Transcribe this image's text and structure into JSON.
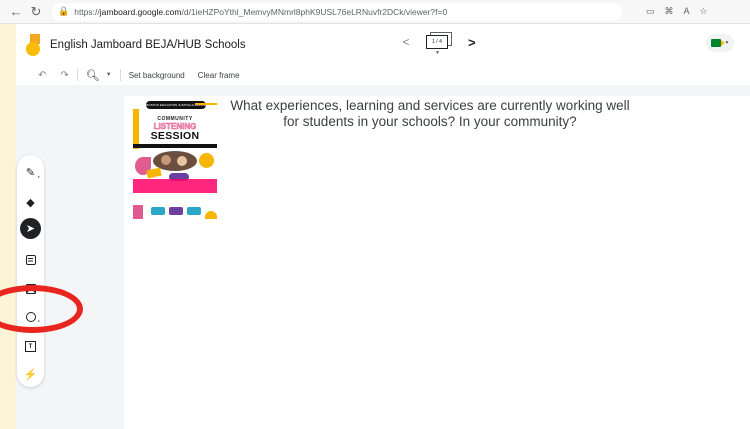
{
  "browser": {
    "url_prefix": "https://",
    "url_host": "jamboard.google.com",
    "url_path": "/d/1ieHZPoYthl_MemvyMNmrl8phK9USL76eLRNuvfr2DCk/viewer?f=0"
  },
  "app": {
    "title": "English Jamboard BEJA/HUB Schools",
    "frame_indicator": "1 / 4"
  },
  "toolbar": {
    "set_background": "Set background",
    "clear_frame": "Clear frame"
  },
  "frame": {
    "prompt": "What experiences, learning and services are currently working well for students in your schools? In your community?"
  },
  "poster": {
    "top_line": "BOSTON EDUCATION JUSTICE ALLIANCE",
    "community": "COMMUNITY",
    "listening": "LISTENING",
    "session": "SESSION"
  },
  "colors": {
    "highlight": "#e8261f",
    "page_bg": "#fdf3d7"
  },
  "icons": [
    "back-icon",
    "forward-icon",
    "reload-icon",
    "lock-icon",
    "jamboard-logo",
    "prev-frame-icon",
    "next-frame-icon",
    "meet-icon",
    "undo-icon",
    "redo-icon",
    "zoom-icon",
    "pen-icon",
    "eraser-icon",
    "select-icon",
    "sticky-note-icon",
    "image-icon",
    "circle-icon",
    "text-box-icon",
    "laser-icon"
  ]
}
